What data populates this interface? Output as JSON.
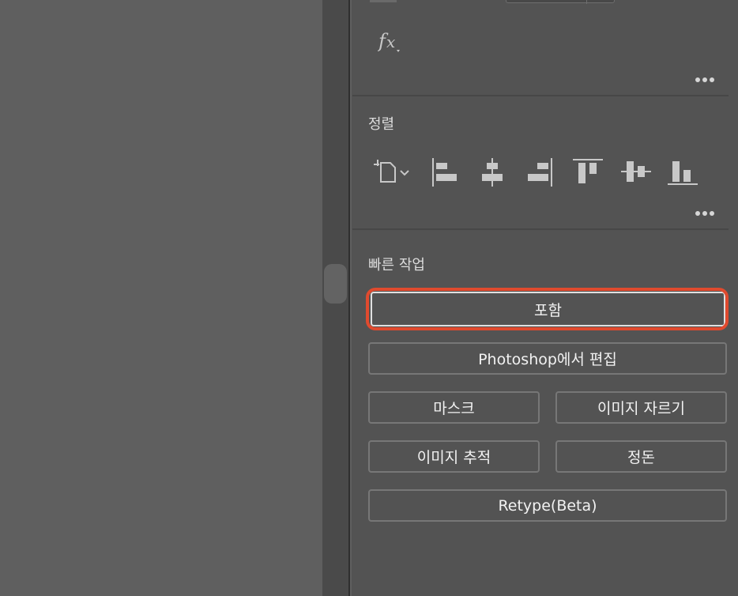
{
  "appearance": {
    "fx_label": "fx",
    "more_glyph": "more-horizontal-icon"
  },
  "align": {
    "title": "정렬",
    "icons": [
      "align-to-selection-icon",
      "align-left-icon",
      "align-horizontal-center-icon",
      "align-right-icon",
      "align-top-icon",
      "align-vertical-center-icon",
      "align-bottom-icon"
    ]
  },
  "quick_actions": {
    "title": "빠른 작업",
    "embed": "포함",
    "edit_photoshop": "Photoshop에서 편집",
    "mask": "마스크",
    "crop_image": "이미지 자르기",
    "image_trace": "이미지 추적",
    "arrange": "정돈",
    "retype": "Retype(Beta)"
  },
  "colors": {
    "panel_bg": "#535353",
    "canvas_bg": "#5f5f5f",
    "highlight": "#e04a2e"
  }
}
